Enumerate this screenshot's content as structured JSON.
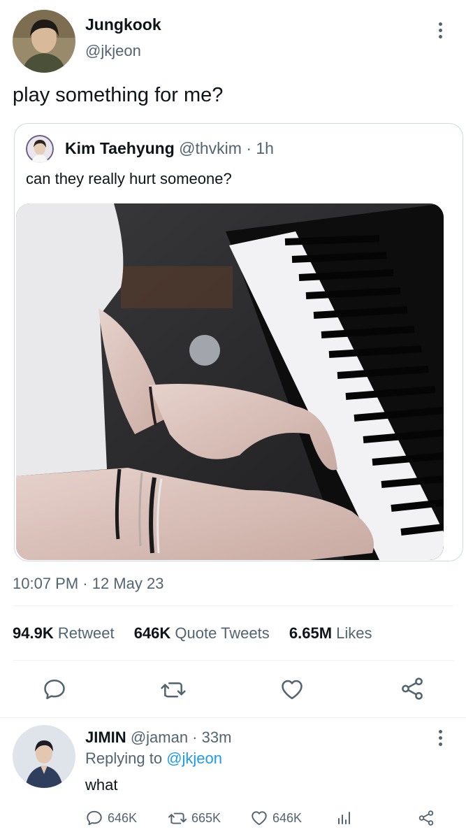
{
  "main_tweet": {
    "author_name": "Jungkook",
    "author_handle": "@jkjeon",
    "text": "play something for me?",
    "timestamp": "10:07 PM · 12 May 23",
    "quote": {
      "name": "Kim Taehyung",
      "meta": "@thvkim · 1h",
      "text": "can they really hurt someone?"
    },
    "stats": {
      "retweets": "94.9K",
      "retweets_label": "Retweet",
      "quotes": "646K",
      "quotes_label": "Quote Tweets",
      "likes": "6.65M",
      "likes_label": "Likes"
    },
    "action_icons": [
      "reply-icon",
      "retweet-icon",
      "like-icon",
      "share-icon"
    ]
  },
  "reply_tweet": {
    "name": "JIMIN",
    "meta": "@jaman · 33m",
    "replying_label": "Replying to",
    "replying_handle": "@jkjeon",
    "text": "what",
    "counts": {
      "replies": "646K",
      "retweets": "665K",
      "likes": "646K"
    }
  },
  "colors": {
    "text_primary": "#0f1419",
    "text_secondary": "#536471",
    "link": "#1d9bf0",
    "border": "#cfd9de"
  }
}
